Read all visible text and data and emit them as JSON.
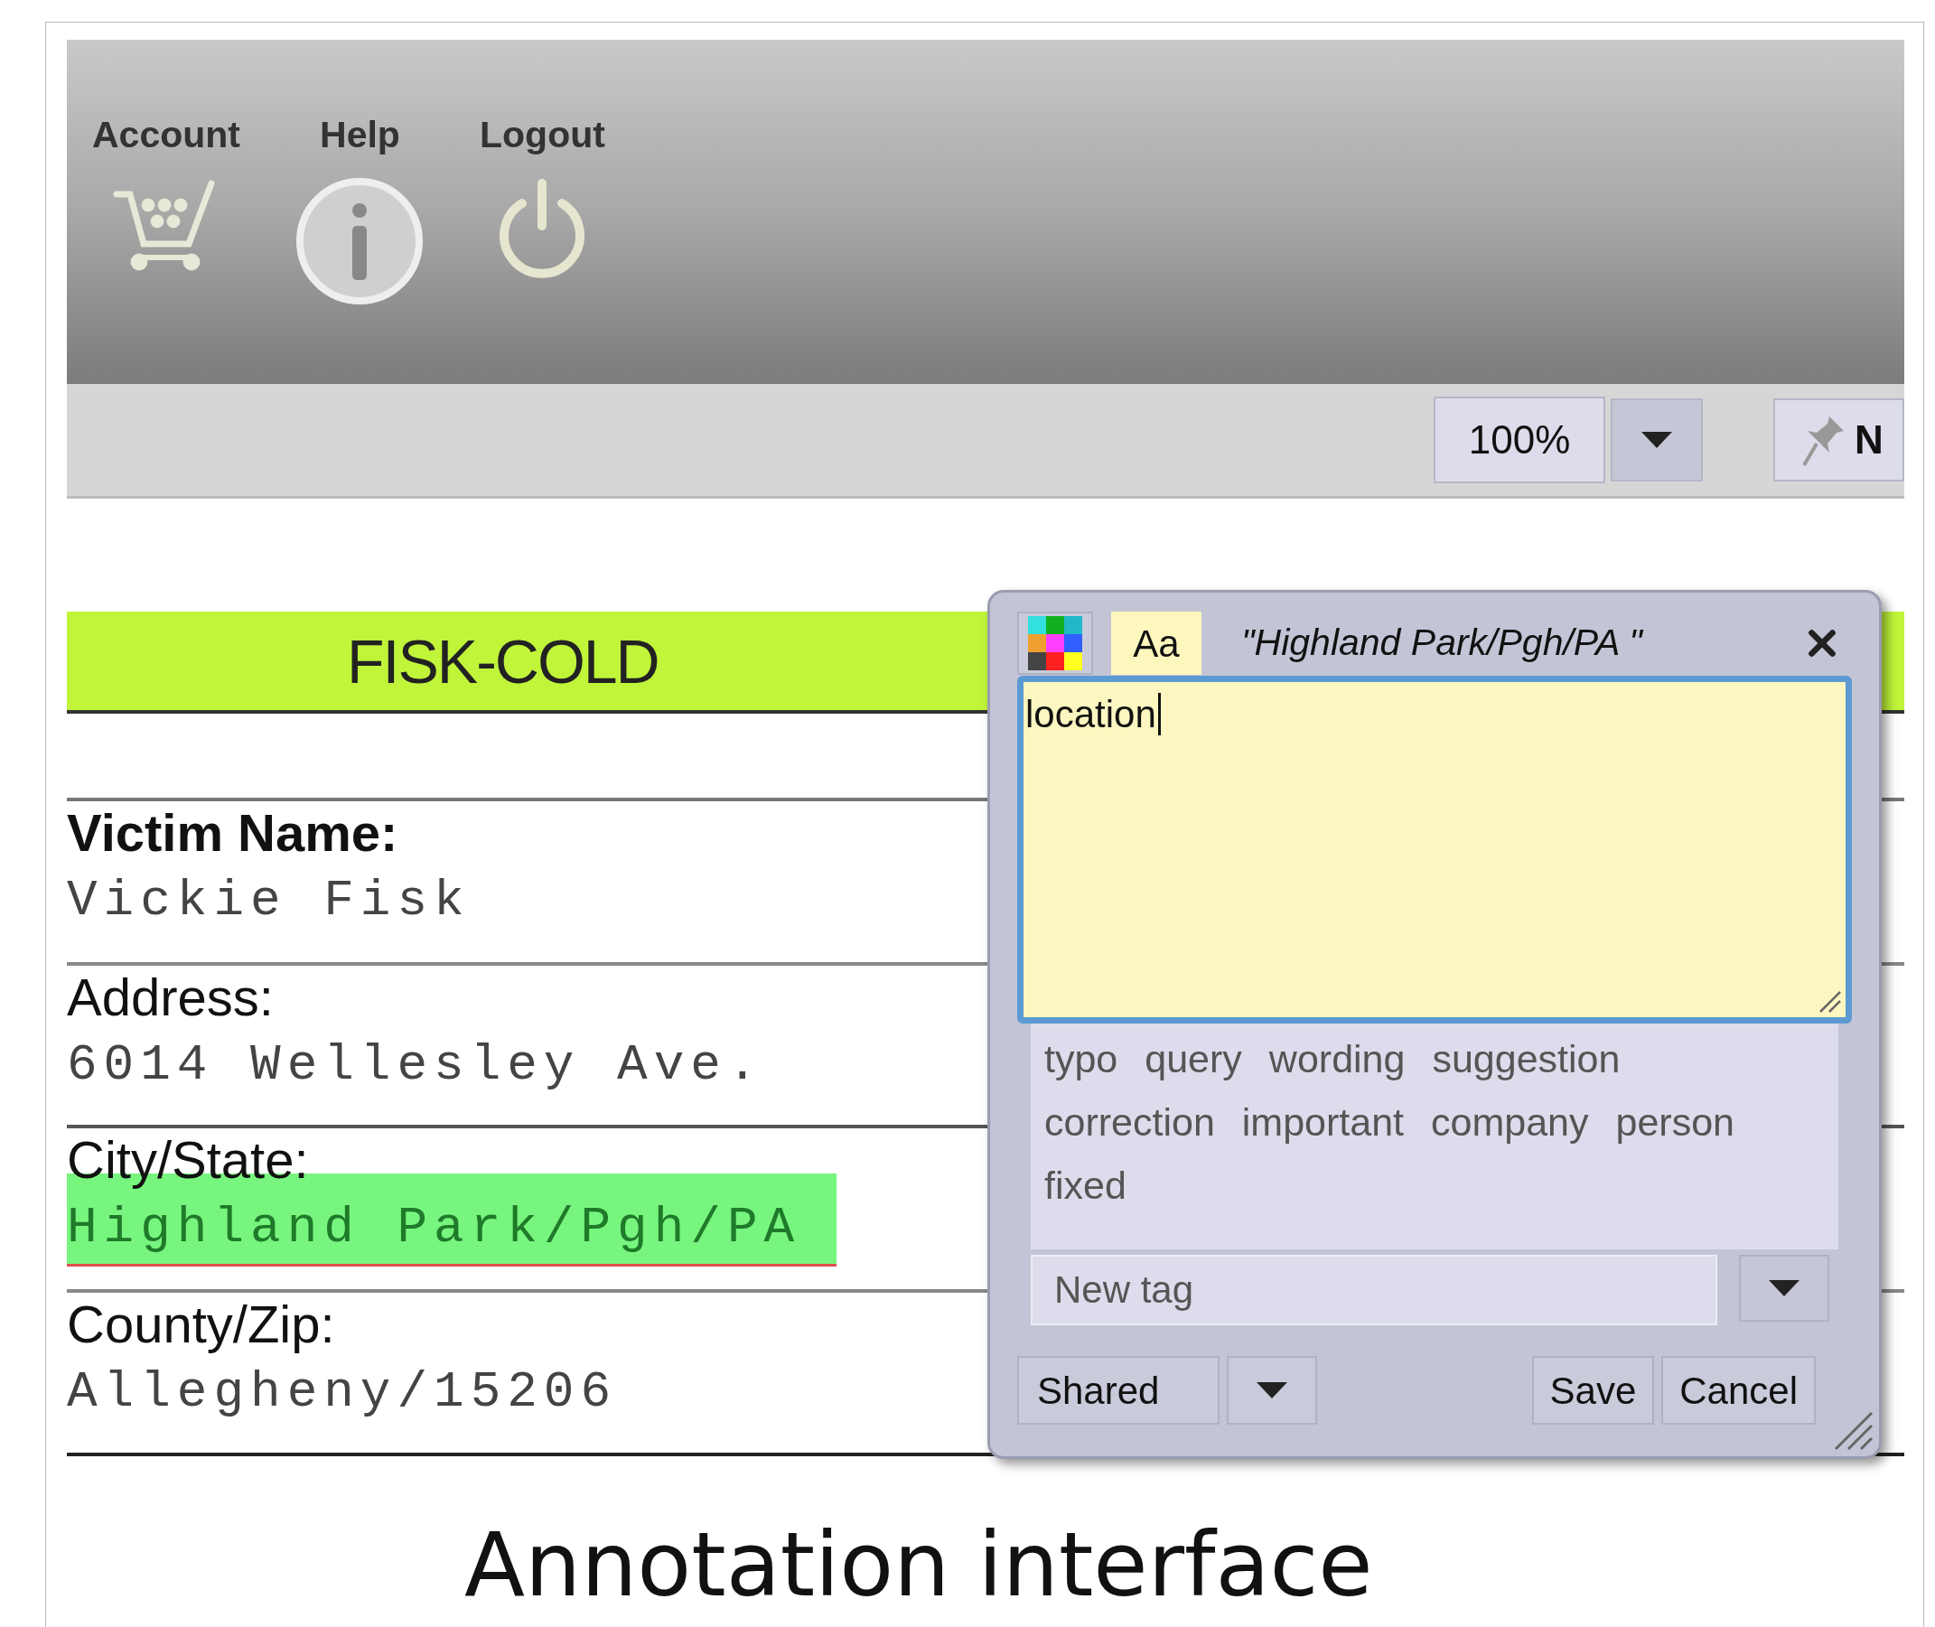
{
  "header": {
    "items": [
      {
        "label": "Account"
      },
      {
        "label": "Help"
      },
      {
        "label": "Logout"
      }
    ]
  },
  "toolbar": {
    "zoom": "100%",
    "pin_button": "N"
  },
  "document": {
    "title": "FISK-COLD",
    "fields": [
      {
        "label": "Victim Name:",
        "value": "Vickie Fisk",
        "highlighted": false
      },
      {
        "label": "Address:",
        "value": "6014 Wellesley Ave.",
        "highlighted": false
      },
      {
        "label": "City/State:",
        "value": "Highland Park/Pgh/PA",
        "highlighted": true
      },
      {
        "label": "County/Zip:",
        "value": "Allegheny/15206",
        "highlighted": false
      }
    ]
  },
  "popup": {
    "font_button": "Aa",
    "quote": "\"Highland Park/Pgh/PA \"",
    "note": "location",
    "tags": [
      "typo",
      "query",
      "wording",
      "suggestion",
      "correction",
      "important",
      "company",
      "person",
      "fixed"
    ],
    "new_tag_placeholder": "New tag",
    "visibility": "Shared",
    "buttons": [
      "Save",
      "Cancel"
    ]
  },
  "caption": "Annotation interface"
}
